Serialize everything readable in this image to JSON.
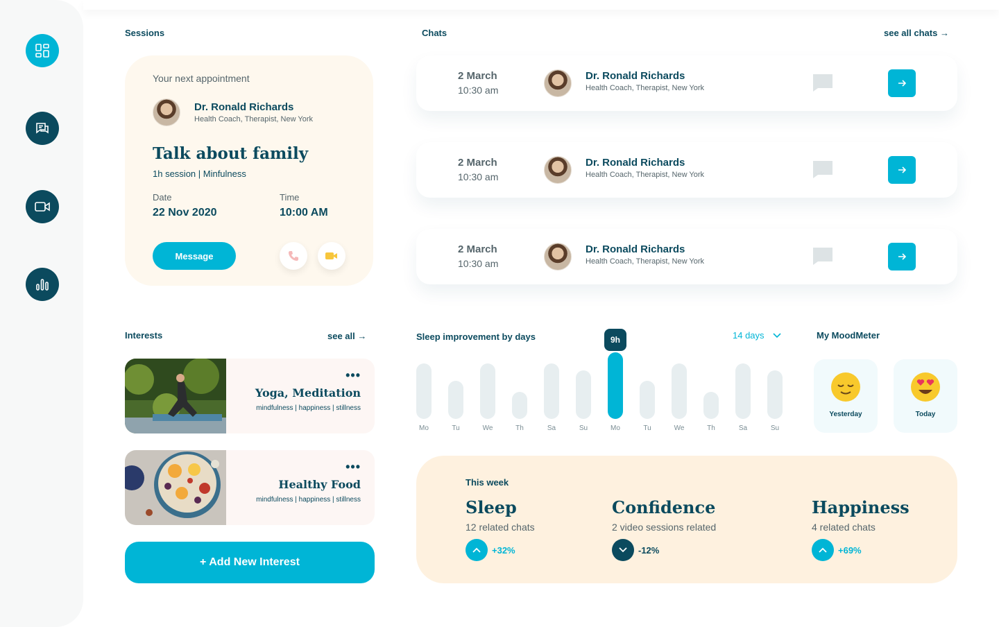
{
  "sidebar": {
    "items": [
      {
        "icon": "dashboard-icon"
      },
      {
        "icon": "chat-icon"
      },
      {
        "icon": "video-icon"
      },
      {
        "icon": "stats-icon"
      }
    ]
  },
  "sessions": {
    "title": "Sessions",
    "next_label": "Your next appointment",
    "doctor_name": "Dr. Ronald Richards",
    "doctor_role": "Health Coach, Therapist, New York",
    "topic": "Talk about family",
    "meta": "1h session | Minfulness",
    "date_label": "Date",
    "date_value": "22 Nov 2020",
    "time_label": "Time",
    "time_value": "10:00 AM",
    "message_label": "Message"
  },
  "chats": {
    "title": "Chats",
    "see_all": "see all chats →",
    "items": [
      {
        "date": "2 March",
        "time": "10:30 am",
        "name": "Dr. Ronald Richards",
        "role": "Health Coach, Therapist, New York"
      },
      {
        "date": "2 March",
        "time": "10:30 am",
        "name": "Dr. Ronald Richards",
        "role": "Health Coach, Therapist, New York"
      },
      {
        "date": "2 March",
        "time": "10:30 am",
        "name": "Dr. Ronald Richards",
        "role": "Health Coach, Therapist, New York"
      }
    ]
  },
  "interests": {
    "title": "Interests",
    "see_all": "see all →",
    "items": [
      {
        "title": "Yoga, Meditation",
        "tags": "mindfulness | happiness | stillness"
      },
      {
        "title": "Healthy Food",
        "tags": "mindfulness | happiness | stillness"
      }
    ],
    "add_label": "+ Add New Interest"
  },
  "sleep": {
    "title": "Sleep improvement by days",
    "range": "14 days",
    "tooltip": "9h",
    "colors": {
      "bar": "#e7eef0",
      "active": "#00b5d6"
    }
  },
  "chart_data": {
    "type": "bar",
    "categories": [
      "Mo",
      "Tu",
      "We",
      "Th",
      "Sa",
      "Su",
      "Mo",
      "Tu",
      "We",
      "Th",
      "Sa",
      "Su"
    ],
    "values": [
      7.5,
      5.2,
      7.5,
      3.7,
      7.5,
      6.6,
      9,
      5.2,
      7.5,
      3.7,
      7.5,
      6.6
    ],
    "active_index": 6,
    "ylim": [
      0,
      9
    ]
  },
  "moodmeter": {
    "title": "My MoodMeter",
    "items": [
      {
        "label": "Yesterday",
        "icon": "relieved-face-icon"
      },
      {
        "label": "Today",
        "icon": "heart-eyes-face-icon"
      }
    ]
  },
  "this_week": {
    "label": "This week",
    "items": [
      {
        "title": "Sleep",
        "sub": "12 related chats",
        "change": "+32%",
        "direction": "up"
      },
      {
        "title": "Confidence",
        "sub": "2 video sessions related",
        "change": "-12%",
        "direction": "down"
      },
      {
        "title": "Happiness",
        "sub": "4 related chats",
        "change": "+69%",
        "direction": "up"
      }
    ]
  }
}
